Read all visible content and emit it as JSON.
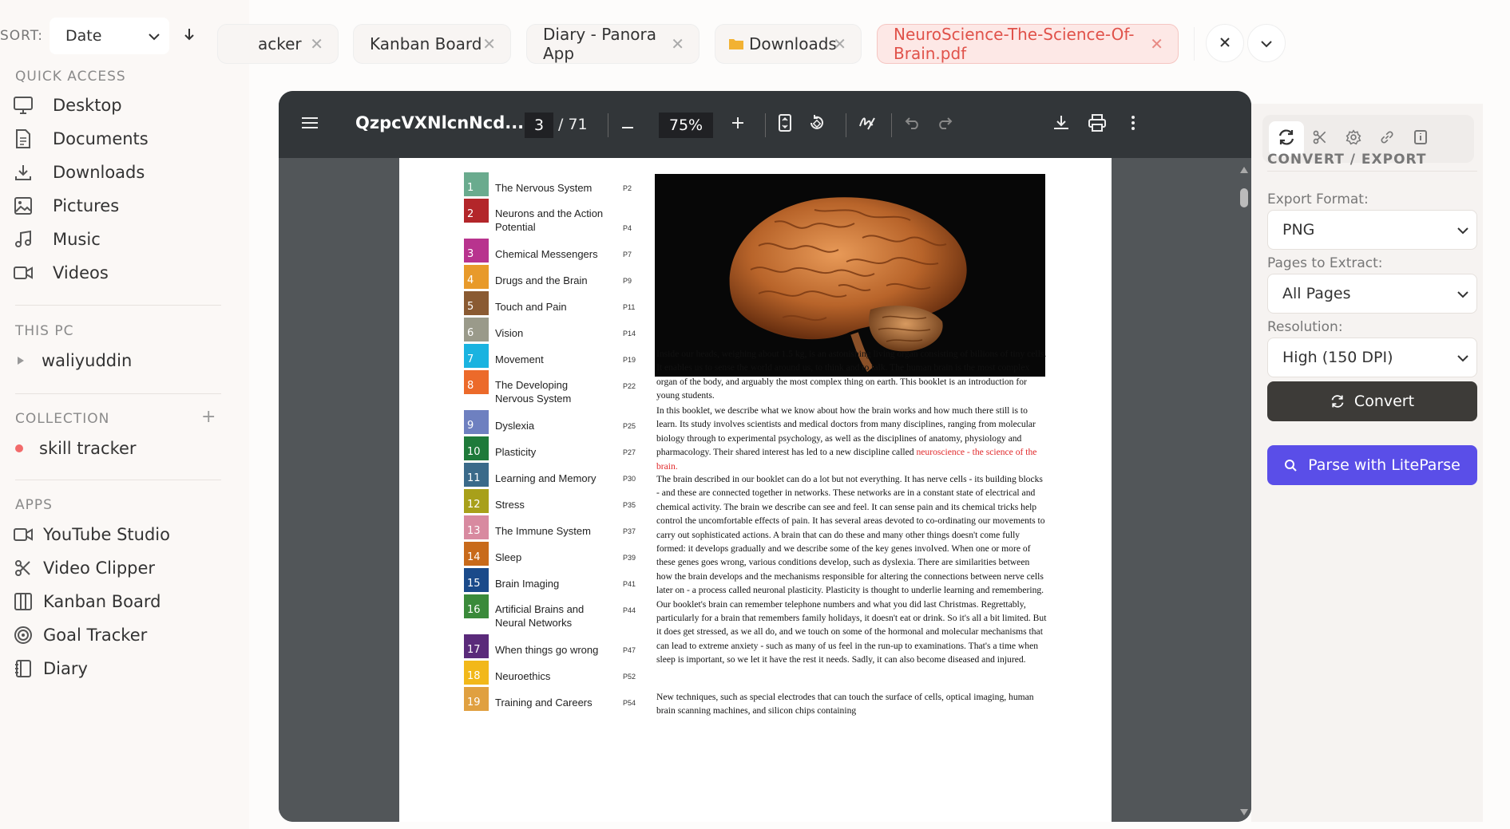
{
  "sidebar": {
    "sort_label": "SORT:",
    "sort_value": "Date",
    "quick_access_title": "QUICK ACCESS",
    "quick_access": [
      {
        "label": "Desktop",
        "icon": "monitor-icon"
      },
      {
        "label": "Documents",
        "icon": "document-icon"
      },
      {
        "label": "Downloads",
        "icon": "download-icon"
      },
      {
        "label": "Pictures",
        "icon": "image-icon"
      },
      {
        "label": "Music",
        "icon": "music-icon"
      },
      {
        "label": "Videos",
        "icon": "video-icon"
      }
    ],
    "this_pc_title": "THIS PC",
    "this_pc_item": "waliyuddin",
    "collection_title": "COLLECTION",
    "collection_item": "skill tracker",
    "collection_dot_color": "#f26b6b",
    "apps_title": "APPS",
    "apps": [
      {
        "label": "YouTube Studio",
        "icon": "video-icon"
      },
      {
        "label": "Video Clipper",
        "icon": "scissors-icon"
      },
      {
        "label": "Kanban Board",
        "icon": "columns-icon"
      },
      {
        "label": "Goal Tracker",
        "icon": "target-icon"
      },
      {
        "label": "Diary",
        "icon": "notebook-icon"
      }
    ]
  },
  "tabs": [
    {
      "label": "acker"
    },
    {
      "label": "Kanban Board"
    },
    {
      "label": "Diary - Panora App"
    },
    {
      "label": "Downloads",
      "icon": "folder-icon"
    },
    {
      "label": "NeuroScience-The-Science-Of-Brain.pdf",
      "active": true
    }
  ],
  "viewer": {
    "title": "QzpcVXNlcnNcd...",
    "current_page": "3",
    "total_pages": "/ 71",
    "zoom": "75%"
  },
  "page": {
    "toc": [
      {
        "num": "1",
        "title": "The Nervous System",
        "page": "P2",
        "color": "#6aab8e"
      },
      {
        "num": "2",
        "title": "Neurons and the Action Potential",
        "page": "P4",
        "color": "#b3262a"
      },
      {
        "num": "3",
        "title": "Chemical Messengers",
        "page": "P7",
        "color": "#b8338e"
      },
      {
        "num": "4",
        "title": "Drugs and the Brain",
        "page": "P9",
        "color": "#e89a2a"
      },
      {
        "num": "5",
        "title": "Touch and Pain",
        "page": "P11",
        "color": "#8a5a32"
      },
      {
        "num": "6",
        "title": "Vision",
        "page": "P14",
        "color": "#9a9a8a"
      },
      {
        "num": "7",
        "title": "Movement",
        "page": "P19",
        "color": "#1ab3e0"
      },
      {
        "num": "8",
        "title": "The Developing Nervous System",
        "page": "P22",
        "color": "#ec6a2a"
      },
      {
        "num": "9",
        "title": "Dyslexia",
        "page": "P25",
        "color": "#6e80c0"
      },
      {
        "num": "10",
        "title": "Plasticity",
        "page": "P27",
        "color": "#1e7a3a"
      },
      {
        "num": "11",
        "title": "Learning and Memory",
        "page": "P30",
        "color": "#3a6a8a"
      },
      {
        "num": "12",
        "title": "Stress",
        "page": "P35",
        "color": "#a8a01a"
      },
      {
        "num": "13",
        "title": "The Immune System",
        "page": "P37",
        "color": "#d88aa0"
      },
      {
        "num": "14",
        "title": "Sleep",
        "page": "P39",
        "color": "#c86a1a"
      },
      {
        "num": "15",
        "title": "Brain Imaging",
        "page": "P41",
        "color": "#1a4a8a"
      },
      {
        "num": "16",
        "title": "Artificial Brains and Neural Networks",
        "page": "P44",
        "color": "#3a8a3a"
      },
      {
        "num": "17",
        "title": "When things go wrong",
        "page": "P47",
        "color": "#5a2a7a"
      },
      {
        "num": "18",
        "title": "Neuroethics",
        "page": "P52",
        "color": "#f2b81a"
      },
      {
        "num": "19",
        "title": "Training and Careers",
        "page": "P54",
        "color": "#e0a040"
      }
    ],
    "para1": "Inside our heads, weighing about 1.5 kg, is an astonishing living organ consisting of billions of tiny cells.  It enables us to sense the world around us, to think and to talk. The human brain is the most complex organ of the body, and arguably the most complex thing on earth. This booklet is an introduction for young students.",
    "para2": "In this booklet, we describe what we know about how the brain works and how much there still is to learn.  Its study involves scientists and medical doctors from many disciplines, ranging from molecular biology through to experimental psychology, as well as the disciplines of anatomy, physiology and pharmacology. Their shared interest has led to a new discipline called ",
    "para2_red": "neuroscience - the science of the brain.",
    "para3": "The brain described in our booklet can do a lot but not everything.  It has nerve cells - its building blocks - and these are connected together in networks.  These networks are in a constant state of electrical and chemical activity. The brain we describe can see and feel.  It can sense pain and its chemical tricks help control the uncomfortable effects of pain.  It has several areas devoted to co-ordinating our movements to carry out sophisticated actions. A brain that can do these and many other things doesn't come fully formed: it develops gradually and we describe some of the key genes involved.  When one or more of these genes goes wrong, various conditions develop, such as dyslexia. There are similarities between how the brain develops and the mechanisms responsible for altering the connections between nerve cells later on - a process called neuronal plasticity.  Plasticity is thought to underlie learning and remembering.  Our booklet's brain can remember telephone numbers and what you did last Christmas.  Regrettably, particularly for a brain that remembers family holidays, it doesn't eat or drink.  So it's all a bit limited. But it does get stressed, as we all do, and we touch on some of the hormonal and molecular mechanisms that can lead to extreme anxiety - such as many of us feel in the run-up to examinations.  That's a time when sleep is important, so we let it have the rest it needs.  Sadly, it can also become diseased and injured.",
    "para4": "New techniques, such as special electrodes that can touch the surface of cells, optical imaging, human brain scanning machines, and silicon chips containing"
  },
  "right_panel": {
    "section_title": "CONVERT / EXPORT",
    "export_format_label": "Export Format:",
    "export_format_value": "PNG",
    "pages_label": "Pages to Extract:",
    "pages_value": "All Pages",
    "resolution_label": "Resolution:",
    "resolution_value": "High (150 DPI)",
    "convert_label": "Convert",
    "parse_label": "Parse with LiteParse",
    "parse_color": "#5a4ee8",
    "convert_color": "#3d3b38"
  }
}
